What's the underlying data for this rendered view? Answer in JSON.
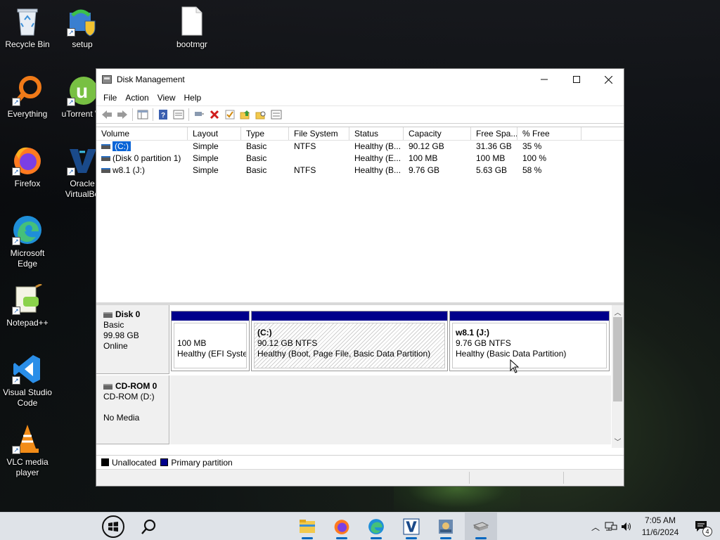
{
  "desktop": {
    "icons": [
      {
        "label": "Recycle Bin"
      },
      {
        "label": "setup"
      },
      {
        "label": "bootmgr"
      },
      {
        "label": "Everything"
      },
      {
        "label": "uTorrent W"
      },
      {
        "label": "Firefox"
      },
      {
        "label": "Oracle VirtualBo"
      },
      {
        "label": "Microsoft Edge"
      },
      {
        "label": "Notepad++"
      },
      {
        "label": "Visual Studio Code"
      },
      {
        "label": "VLC media player"
      }
    ]
  },
  "window": {
    "title": "Disk Management",
    "menu": [
      "File",
      "Action",
      "View",
      "Help"
    ],
    "columns": [
      "Volume",
      "Layout",
      "Type",
      "File System",
      "Status",
      "Capacity",
      "Free Spa...",
      "% Free"
    ],
    "volumes": [
      {
        "volume": "(C:)",
        "layout": "Simple",
        "type": "Basic",
        "fs": "NTFS",
        "status": "Healthy (B...",
        "capacity": "90.12 GB",
        "free": "31.36 GB",
        "pct": "35 %"
      },
      {
        "volume": "(Disk 0 partition 1)",
        "layout": "Simple",
        "type": "Basic",
        "fs": "",
        "status": "Healthy (E...",
        "capacity": "100 MB",
        "free": "100 MB",
        "pct": "100 %"
      },
      {
        "volume": "w8.1 (J:)",
        "layout": "Simple",
        "type": "Basic",
        "fs": "NTFS",
        "status": "Healthy (B...",
        "capacity": "9.76 GB",
        "free": "5.63 GB",
        "pct": "58 %"
      }
    ],
    "disk0": {
      "name": "Disk 0",
      "type": "Basic",
      "size": "99.98 GB",
      "status": "Online",
      "partitions": [
        {
          "name": "",
          "size": "100 MB",
          "status": "Healthy (EFI Syster"
        },
        {
          "name": "(C:)",
          "size": "90.12 GB NTFS",
          "status": "Healthy (Boot, Page File, Basic Data Partition)"
        },
        {
          "name": "w8.1  (J:)",
          "size": "9.76 GB NTFS",
          "status": "Healthy (Basic Data Partition)"
        }
      ]
    },
    "cdrom0": {
      "name": "CD-ROM 0",
      "drive": "CD-ROM (D:)",
      "media": "No Media"
    },
    "legend": [
      {
        "label": "Unallocated",
        "color": "#000000"
      },
      {
        "label": "Primary partition",
        "color": "#00008b"
      }
    ]
  },
  "taskbar": {
    "time": "7:05 AM",
    "date": "11/6/2024",
    "notification_count": "4"
  }
}
